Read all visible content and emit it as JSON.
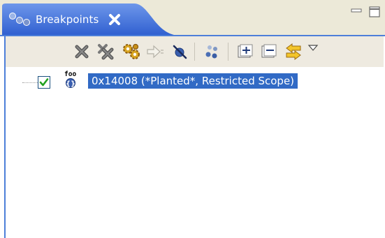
{
  "view": {
    "tab_title": "Breakpoints",
    "tab_icon": "breakpoints-view-icon",
    "accent_color": "#316ac5",
    "tab_color": "#3d6bd4"
  },
  "window_buttons": [
    {
      "name": "minimize-icon"
    },
    {
      "name": "maximize-icon"
    }
  ],
  "toolbar": {
    "buttons": [
      {
        "name": "remove-breakpoint-icon",
        "enabled": true
      },
      {
        "name": "remove-all-breakpoints-icon",
        "enabled": true
      },
      {
        "name": "skip-breakpoints-icon",
        "enabled": true
      },
      {
        "name": "go-to-file-icon",
        "enabled": false
      },
      {
        "name": "skip-all-breakpoints-icon",
        "enabled": true
      },
      {
        "name": "link-with-debug-view-icon",
        "enabled": true
      },
      {
        "name": "expand-all-icon",
        "enabled": true
      },
      {
        "name": "collapse-all-icon",
        "enabled": true
      },
      {
        "name": "link-with-view-icon",
        "enabled": true
      },
      {
        "name": "view-menu-icon",
        "enabled": true
      }
    ]
  },
  "breakpoints": [
    {
      "checked": true,
      "icon": "function-breakpoint-icon",
      "icon_text": "foo",
      "label": "0x14008  (*Planted*, Restricted Scope)",
      "selected": true
    }
  ]
}
